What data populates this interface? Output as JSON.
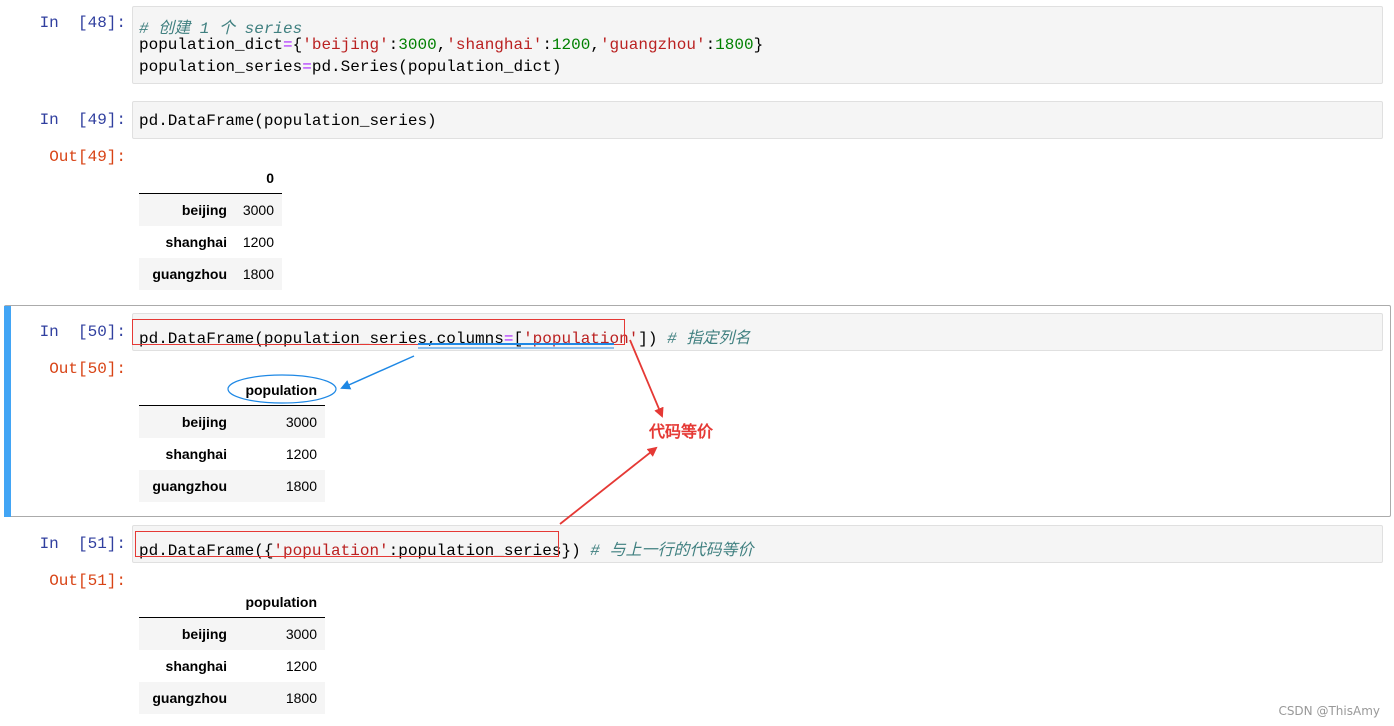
{
  "cells": {
    "c48": {
      "prompt": "In  [48]:",
      "comment": "# 创建 1 个 series",
      "l2_a": "population_dict",
      "l2_eq": "=",
      "l2_b": "{",
      "l2_k1": "'beijing'",
      "l2_c1": ":",
      "l2_v1": "3000",
      "l2_s1": ",",
      "l2_k2": "'shanghai'",
      "l2_c2": ":",
      "l2_v2": "1200",
      "l2_s2": ",",
      "l2_k3": "'guangzhou'",
      "l2_c3": ":",
      "l2_v3": "1800",
      "l2_e": "}",
      "l3_a": "population_series",
      "l3_eq": "=",
      "l3_b": "pd.Series(population_dict)"
    },
    "c49": {
      "prompt": "In  [49]:",
      "code": "pd.DataFrame(population_series)",
      "out_prompt": "Out[49]:",
      "header": "0",
      "rows": [
        {
          "index": "beijing",
          "value": "3000"
        },
        {
          "index": "shanghai",
          "value": "1200"
        },
        {
          "index": "guangzhou",
          "value": "1800"
        }
      ]
    },
    "c50": {
      "prompt": "In  [50]:",
      "code_a": "pd.DataFrame(population_series,columns",
      "code_eq": "=",
      "code_b": "[",
      "code_str": "'population'",
      "code_c": "])",
      "comment": "# 指定列名",
      "out_prompt": "Out[50]:",
      "header": "population",
      "rows": [
        {
          "index": "beijing",
          "value": "3000"
        },
        {
          "index": "shanghai",
          "value": "1200"
        },
        {
          "index": "guangzhou",
          "value": "1800"
        }
      ]
    },
    "c51": {
      "prompt": "In  [51]:",
      "code_a": "pd.DataFrame({",
      "code_str": "'population'",
      "code_b": ":population_series})",
      "comment": "# 与上一行的代码等价",
      "out_prompt": "Out[51]:",
      "header": "population",
      "rows": [
        {
          "index": "beijing",
          "value": "3000"
        },
        {
          "index": "shanghai",
          "value": "1200"
        },
        {
          "index": "guangzhou",
          "value": "1800"
        }
      ]
    }
  },
  "annotation": {
    "label": "代码等价",
    "color": "#e53935",
    "arrow_blue": "#1e88e5"
  },
  "watermark": "CSDN @ThisAmy",
  "colors": {
    "selected_bar": "#42a5f5",
    "in_prompt": "#303f9f",
    "out_prompt": "#d84315"
  }
}
